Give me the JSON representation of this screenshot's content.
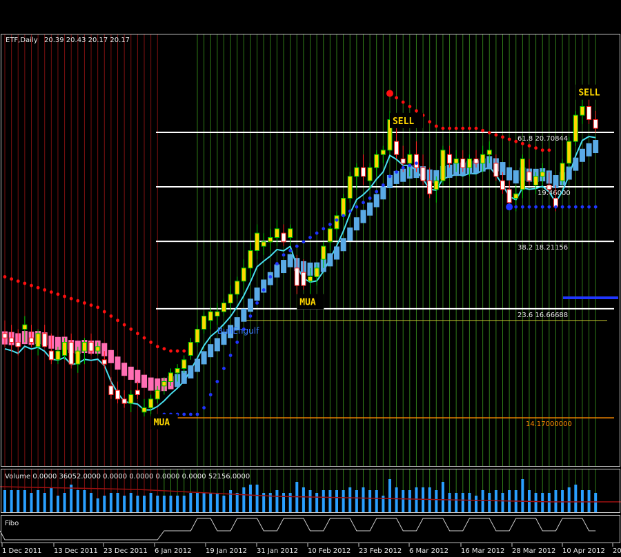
{
  "header": {
    "symbol": "ETF,Daily",
    "ohlc": "20.39 20.43 20.17 20.17"
  },
  "volume_panel": {
    "label": "Volume 0.0000 36052.0000 0.0000 0.0000 0.0000 0.0000 52156.0000"
  },
  "fibo_panel": {
    "label": "Fibo"
  },
  "colors": {
    "background": "#000000",
    "frame": "#c8c8c8",
    "bull": "#00c800",
    "bull_body": "#ffd800",
    "bear": "#ff2020",
    "cyan_band": "#48e0f0",
    "light_blue_band": "#5aaae6",
    "pink_band": "#ff6eb4",
    "red_dots": "#ff1010",
    "blue_dots": "#2036ff",
    "green_vlines": "#2f7a18",
    "red_vlines": "#7a1010",
    "fib_lines": "#ffffff",
    "orange_line": "#ff8c00"
  },
  "chart_data": {
    "type": "candlestick",
    "ylim": [
      13.05,
      22.95
    ],
    "x_tick_labels": [
      {
        "date": "2011-12-01",
        "label": "1 Dec 2011"
      },
      {
        "date": "2011-12-13",
        "label": "13 Dec 2011"
      },
      {
        "date": "2011-12-23",
        "label": "23 Dec 2011"
      },
      {
        "date": "2012-01-06",
        "label": "6 Jan 2012"
      },
      {
        "date": "2012-01-19",
        "label": "19 Jan 2012"
      },
      {
        "date": "2012-01-31",
        "label": "31 Jan 2012"
      },
      {
        "date": "2012-02-10",
        "label": "10 Feb 2012"
      },
      {
        "date": "2012-02-23",
        "label": "23 Feb 2012"
      },
      {
        "date": "2012-03-06",
        "label": "6 Mar 2012"
      },
      {
        "date": "2012-03-16",
        "label": "16 Mar 2012"
      },
      {
        "date": "2012-03-28",
        "label": "28 Mar 2012"
      },
      {
        "date": "2012-04-10",
        "label": "10 Apr 2012"
      },
      {
        "date": "2012-04-20",
        "label": "20"
      }
    ],
    "fib_levels": [
      {
        "ratio": "61.8",
        "value": 20.70844,
        "label": "61.8    20.70844"
      },
      {
        "ratio": "",
        "value": 19.46,
        "label": "19.46000"
      },
      {
        "ratio": "38.2",
        "value": 18.21156,
        "label": "38.2    18.21156"
      },
      {
        "ratio": "23.6",
        "value": 16.66688,
        "label": "23.6    16.66688"
      }
    ],
    "support_level": {
      "value": 14.17,
      "label": "14.17000000"
    },
    "signals": [
      {
        "text": "MUA",
        "index": 22,
        "price": 14.0
      },
      {
        "text": "MUA",
        "index": 44,
        "price": 16.75
      },
      {
        "text": "SELL",
        "index": 58,
        "price": 20.9
      },
      {
        "text": "SELL",
        "index": 86,
        "price": 21.55
      }
    ],
    "annotations": [
      {
        "text": "BullEngulf",
        "index": 32,
        "price": 16.1
      }
    ],
    "candles": [
      [
        16.1,
        16.4,
        15.8,
        16.0
      ],
      [
        16.0,
        16.3,
        15.7,
        15.9
      ],
      [
        15.9,
        16.2,
        15.6,
        15.8
      ],
      [
        16.2,
        16.5,
        15.9,
        16.3
      ],
      [
        16.0,
        16.3,
        15.8,
        15.9
      ],
      [
        15.8,
        16.2,
        15.6,
        16.1
      ],
      [
        16.1,
        16.3,
        15.8,
        15.8
      ],
      [
        15.7,
        16.1,
        15.4,
        15.5
      ],
      [
        15.5,
        15.8,
        15.4,
        15.7
      ],
      [
        15.6,
        16.0,
        15.5,
        15.9
      ],
      [
        15.9,
        16.1,
        15.3,
        15.4
      ],
      [
        15.4,
        15.8,
        15.2,
        15.7
      ],
      [
        15.7,
        16.0,
        15.4,
        15.9
      ],
      [
        15.9,
        16.1,
        15.6,
        15.7
      ],
      [
        15.7,
        15.9,
        15.6,
        15.8
      ],
      [
        15.5,
        15.7,
        15.3,
        15.4
      ],
      [
        14.9,
        15.1,
        14.6,
        14.7
      ],
      [
        14.8,
        15.0,
        14.5,
        14.6
      ],
      [
        14.6,
        14.8,
        14.4,
        14.5
      ],
      [
        14.5,
        14.8,
        14.3,
        14.7
      ],
      [
        14.8,
        15.0,
        14.6,
        14.7
      ],
      [
        14.3,
        14.6,
        14.2,
        14.4
      ],
      [
        14.4,
        14.7,
        14.2,
        14.6
      ],
      [
        14.6,
        14.9,
        14.5,
        14.8
      ],
      [
        14.9,
        15.1,
        14.7,
        15.0
      ],
      [
        15.0,
        15.3,
        14.9,
        15.2
      ],
      [
        15.2,
        15.4,
        15.0,
        15.3
      ],
      [
        15.3,
        15.6,
        15.2,
        15.5
      ],
      [
        15.6,
        16.0,
        15.5,
        15.9
      ],
      [
        15.9,
        16.3,
        15.8,
        16.2
      ],
      [
        16.2,
        16.6,
        16.1,
        16.5
      ],
      [
        16.4,
        16.7,
        16.2,
        16.6
      ],
      [
        16.5,
        16.8,
        16.3,
        16.6
      ],
      [
        16.6,
        16.9,
        16.5,
        16.8
      ],
      [
        16.8,
        17.2,
        16.6,
        17.0
      ],
      [
        17.0,
        17.4,
        16.9,
        17.3
      ],
      [
        17.3,
        17.8,
        17.1,
        17.6
      ],
      [
        17.6,
        18.2,
        17.4,
        18.0
      ],
      [
        18.0,
        18.6,
        17.8,
        18.4
      ],
      [
        18.1,
        18.4,
        17.9,
        18.2
      ],
      [
        18.2,
        18.5,
        18.0,
        18.3
      ],
      [
        18.3,
        18.7,
        18.1,
        18.5
      ],
      [
        18.4,
        18.6,
        18.1,
        18.2
      ],
      [
        18.3,
        18.6,
        18.1,
        18.5
      ],
      [
        17.6,
        17.9,
        17.0,
        17.2
      ],
      [
        17.5,
        17.8,
        17.1,
        17.2
      ],
      [
        17.3,
        17.6,
        17.0,
        17.4
      ],
      [
        17.4,
        17.7,
        17.2,
        17.6
      ],
      [
        17.8,
        18.2,
        17.6,
        18.1
      ],
      [
        18.2,
        18.6,
        18.0,
        18.5
      ],
      [
        18.5,
        18.9,
        18.3,
        18.8
      ],
      [
        18.8,
        19.3,
        18.7,
        19.2
      ],
      [
        19.2,
        19.8,
        19.1,
        19.7
      ],
      [
        19.7,
        20.0,
        19.4,
        19.9
      ],
      [
        19.9,
        20.2,
        19.5,
        19.7
      ],
      [
        19.6,
        20.0,
        19.4,
        19.9
      ],
      [
        19.9,
        20.3,
        19.7,
        20.2
      ],
      [
        20.2,
        20.4,
        20.0,
        20.3
      ],
      [
        20.3,
        21.2,
        20.2,
        21.0
      ],
      [
        20.5,
        20.8,
        20.1,
        20.2
      ],
      [
        20.1,
        20.4,
        19.8,
        20.0
      ],
      [
        20.0,
        20.3,
        19.7,
        20.2
      ],
      [
        20.2,
        20.5,
        19.8,
        19.9
      ],
      [
        19.9,
        20.2,
        19.5,
        19.6
      ],
      [
        19.6,
        19.9,
        19.2,
        19.3
      ],
      [
        19.4,
        19.7,
        19.1,
        19.6
      ],
      [
        19.6,
        20.4,
        19.5,
        20.3
      ],
      [
        20.2,
        20.4,
        19.9,
        20.0
      ],
      [
        20.0,
        20.3,
        19.8,
        20.1
      ],
      [
        20.1,
        20.3,
        19.8,
        19.9
      ],
      [
        19.9,
        20.2,
        19.7,
        20.1
      ],
      [
        20.1,
        20.3,
        19.9,
        20.0
      ],
      [
        20.0,
        20.4,
        19.8,
        20.2
      ],
      [
        20.2,
        20.5,
        20.0,
        20.3
      ],
      [
        20.0,
        20.2,
        19.6,
        19.7
      ],
      [
        19.6,
        19.8,
        19.3,
        19.4
      ],
      [
        19.4,
        19.6,
        19.0,
        19.1
      ],
      [
        19.2,
        19.5,
        18.9,
        19.3
      ],
      [
        19.4,
        20.2,
        19.2,
        20.1
      ],
      [
        19.8,
        20.1,
        19.5,
        19.6
      ],
      [
        19.5,
        19.8,
        19.3,
        19.7
      ],
      [
        19.7,
        20.0,
        19.5,
        19.8
      ],
      [
        19.5,
        19.8,
        19.3,
        19.4
      ],
      [
        19.2,
        19.5,
        18.9,
        19.0
      ],
      [
        19.6,
        20.1,
        19.5,
        20.0
      ],
      [
        20.0,
        20.6,
        19.9,
        20.5
      ],
      [
        20.5,
        21.2,
        20.4,
        21.1
      ],
      [
        21.1,
        21.5,
        20.9,
        21.3
      ],
      [
        21.3,
        21.5,
        20.9,
        21.0
      ],
      [
        21.0,
        21.2,
        20.7,
        20.8
      ]
    ],
    "upper_dots_start_index": 0,
    "upper_dots": [
      17.4,
      17.35,
      17.3,
      17.25,
      17.2,
      17.15,
      17.1,
      17.05,
      17.0,
      16.95,
      16.9,
      16.85,
      16.8,
      16.75,
      16.7,
      16.6,
      16.5,
      16.4,
      16.3,
      16.2,
      16.1,
      16.0,
      15.9,
      15.8,
      15.75,
      15.7,
      15.7,
      15.7
    ],
    "upper_dots2_start_index": 58,
    "upper_dots2": [
      21.6,
      21.5,
      21.4,
      21.3,
      21.2,
      21.1,
      20.95,
      20.85,
      20.8,
      20.8,
      20.8,
      20.8,
      20.8,
      20.8,
      20.75,
      20.7,
      20.65,
      20.6,
      20.55,
      20.5,
      20.45,
      20.4,
      20.35,
      20.3,
      20.3
    ],
    "lower_dots_start_index": 24,
    "lower_dots": [
      14.25,
      14.25,
      14.25,
      14.25,
      14.25,
      14.25,
      14.4,
      14.7,
      15.0,
      15.3,
      15.6,
      15.9,
      16.2,
      16.5,
      16.8,
      17.1,
      17.4,
      17.7,
      17.9,
      18.0,
      18.1,
      18.2,
      18.3,
      18.4,
      18.5,
      18.6,
      18.7,
      18.8,
      18.9,
      19.0,
      19.1,
      19.2,
      19.35,
      19.5,
      19.7,
      19.8,
      19.9,
      19.95,
      20.0
    ],
    "lower_dots2_start_index": 76,
    "lower_dots2": [
      19.0,
      19.0,
      19.0,
      19.0,
      19.0,
      19.0,
      19.0,
      19.0,
      19.0,
      19.0,
      19.0,
      19.0,
      19.0,
      19.0
    ]
  }
}
